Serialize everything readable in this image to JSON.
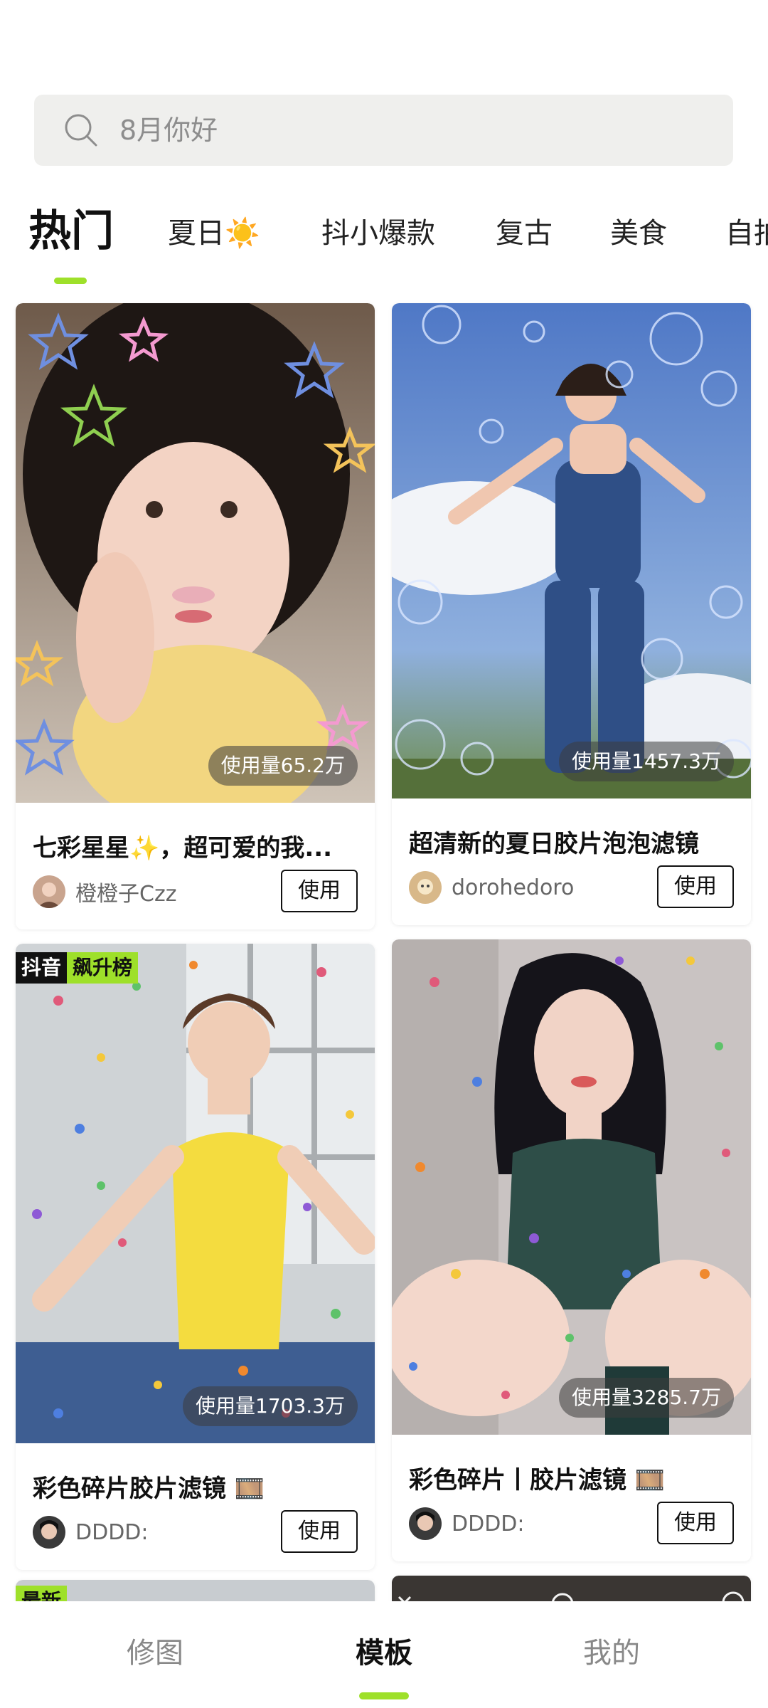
{
  "search": {
    "placeholder": "8月你好"
  },
  "tabs": [
    {
      "label": "热门",
      "active": true
    },
    {
      "label": "夏日☀️"
    },
    {
      "label": "抖小爆款"
    },
    {
      "label": "复古"
    },
    {
      "label": "美食"
    },
    {
      "label": "自拍"
    }
  ],
  "cards": [
    {
      "title": "七彩星星✨，超可爱的我...",
      "usage": "使用量65.2万",
      "author": "橙橙子Czz",
      "use_label": "使用"
    },
    {
      "title": "超清新的夏日胶片泡泡滤镜",
      "usage": "使用量1457.3万",
      "author": "dorohedoro",
      "use_label": "使用"
    },
    {
      "title": "彩色碎片胶片滤镜 🎞️",
      "usage": "使用量1703.3万",
      "author": "DDDD:",
      "use_label": "使用",
      "badges": [
        "抖音",
        "飙升榜"
      ]
    },
    {
      "title": "彩色碎片丨胶片滤镜 🎞️",
      "usage": "使用量3285.7万",
      "author": "DDDD:",
      "use_label": "使用"
    },
    {
      "badge": "最新"
    }
  ],
  "bottom_nav": [
    {
      "label": "修图"
    },
    {
      "label": "模板",
      "active": true
    },
    {
      "label": "我的"
    }
  ],
  "colors": {
    "accent": "#9ee02a",
    "search_bg": "#efefed"
  }
}
